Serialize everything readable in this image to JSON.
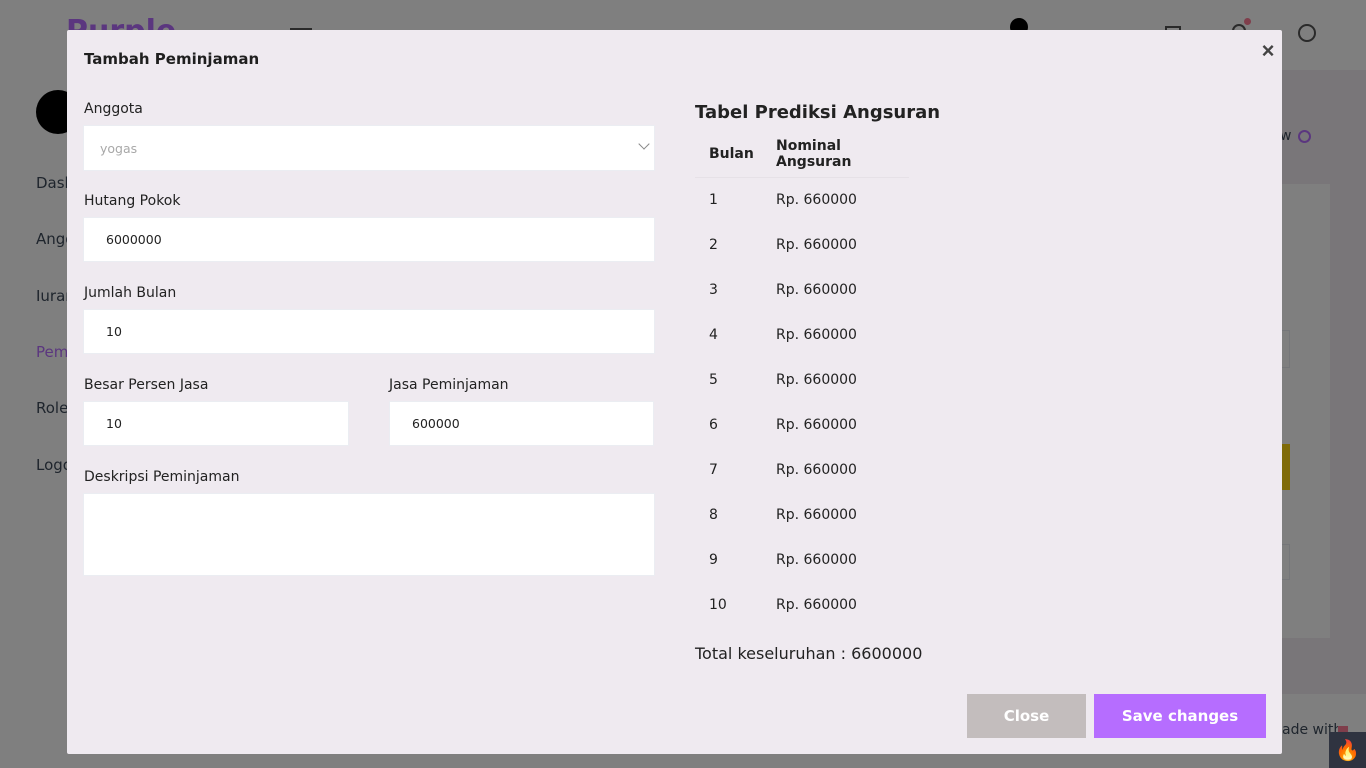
{
  "modal": {
    "title": "Tambah Peminjaman",
    "close_glyph": "×",
    "form": {
      "anggota_label": "Anggota",
      "anggota_value": "yogas",
      "hutang_label": "Hutang Pokok",
      "hutang_value": "6000000",
      "bulan_label": "Jumlah Bulan",
      "bulan_value": "10",
      "persen_label": "Besar Persen Jasa",
      "persen_value": "10",
      "jasa_label": "Jasa Peminjaman",
      "jasa_value": "600000",
      "deskripsi_label": "Deskripsi Peminjaman",
      "deskripsi_value": ""
    },
    "table": {
      "title": "Tabel Prediksi Angsuran",
      "headers": [
        "Bulan",
        "Nominal Angsuran"
      ],
      "rows": [
        [
          "1",
          "Rp. 660000"
        ],
        [
          "2",
          "Rp. 660000"
        ],
        [
          "3",
          "Rp. 660000"
        ],
        [
          "4",
          "Rp. 660000"
        ],
        [
          "5",
          "Rp. 660000"
        ],
        [
          "6",
          "Rp. 660000"
        ],
        [
          "7",
          "Rp. 660000"
        ],
        [
          "8",
          "Rp. 660000"
        ],
        [
          "9",
          "Rp. 660000"
        ],
        [
          "10",
          "Rp. 660000"
        ]
      ],
      "total": "Total keseluruhan : 6600000"
    },
    "buttons": {
      "close": "Close",
      "save": "Save changes"
    }
  },
  "background": {
    "brand": "Purple",
    "nav": [
      "Dash",
      "Angg",
      "Iuran",
      "Pemi",
      "Role",
      "Logo"
    ],
    "overview": "w",
    "footer": "ade with"
  },
  "colors": {
    "accent": "#b66dff",
    "close_button": "#c3bdbd",
    "modal_bg": "#efeaf0"
  }
}
